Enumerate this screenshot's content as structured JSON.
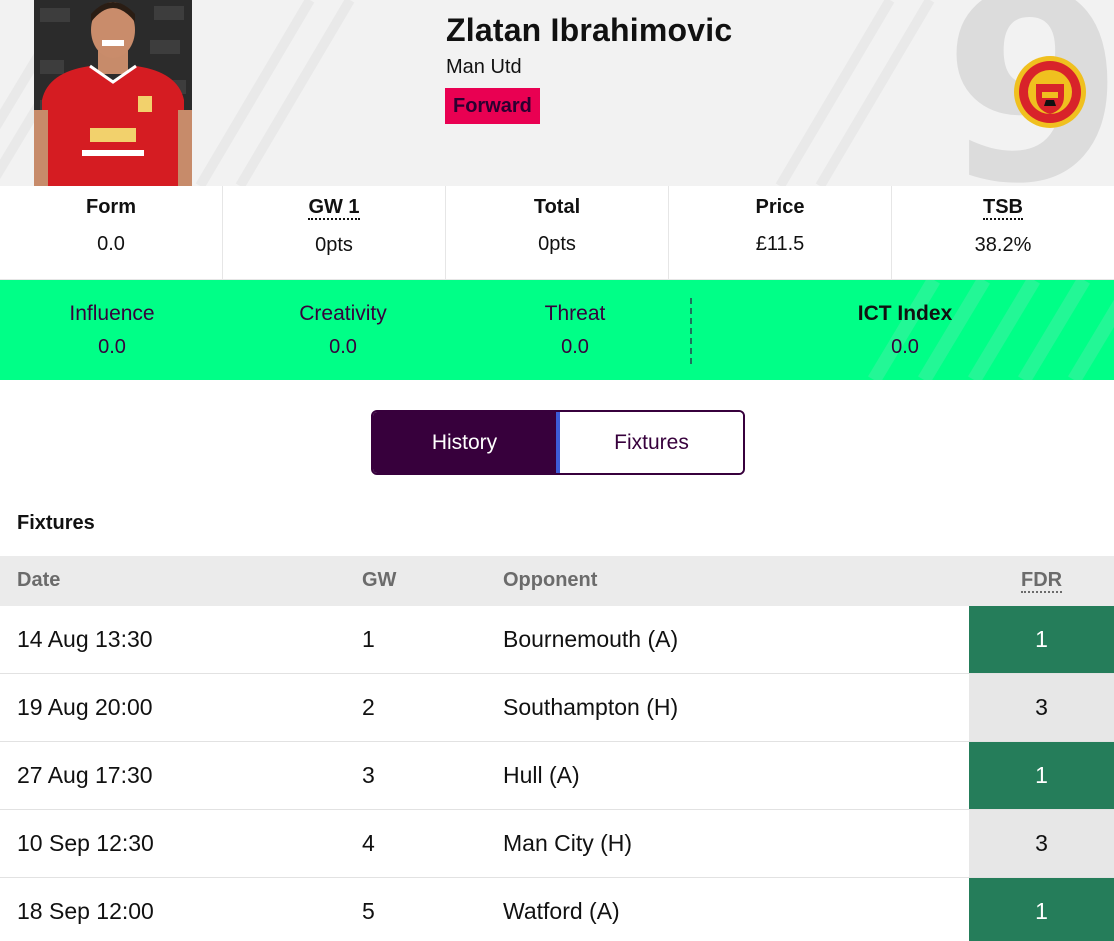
{
  "player": {
    "name": "Zlatan Ibrahimovic",
    "team": "Man Utd",
    "position": "Forward",
    "shirt_number": "9"
  },
  "stats": [
    {
      "label": "Form",
      "value": "0.0",
      "dotted": false
    },
    {
      "label": "GW 1",
      "value": "0pts",
      "dotted": true
    },
    {
      "label": "Total",
      "value": "0pts",
      "dotted": false
    },
    {
      "label": "Price",
      "value": "£11.5",
      "dotted": false
    },
    {
      "label": "TSB",
      "value": "38.2%",
      "dotted": true
    }
  ],
  "ict": {
    "influence": {
      "label": "Influence",
      "value": "0.0"
    },
    "creativity": {
      "label": "Creativity",
      "value": "0.0"
    },
    "threat": {
      "label": "Threat",
      "value": "0.0"
    },
    "index": {
      "label": "ICT Index",
      "value": "0.0"
    }
  },
  "tabs": {
    "history": "History",
    "fixtures": "Fixtures",
    "active": "history"
  },
  "fixtures": {
    "title": "Fixtures",
    "headers": {
      "date": "Date",
      "gw": "GW",
      "opponent": "Opponent",
      "fdr": "FDR"
    },
    "rows": [
      {
        "date": "14 Aug 13:30",
        "gw": "1",
        "opponent": "Bournemouth (A)",
        "fdr": "1"
      },
      {
        "date": "19 Aug 20:00",
        "gw": "2",
        "opponent": "Southampton (H)",
        "fdr": "3"
      },
      {
        "date": "27 Aug 17:30",
        "gw": "3",
        "opponent": "Hull (A)",
        "fdr": "1"
      },
      {
        "date": "10 Sep 12:30",
        "gw": "4",
        "opponent": "Man City (H)",
        "fdr": "3"
      },
      {
        "date": "18 Sep 12:00",
        "gw": "5",
        "opponent": "Watford (A)",
        "fdr": "1"
      }
    ]
  },
  "colors": {
    "position_badge": "#e90052",
    "ict_band": "#00ff87",
    "primary": "#37003c",
    "fdr_1": "#257d5a",
    "fdr_3": "#e7e7e7"
  }
}
